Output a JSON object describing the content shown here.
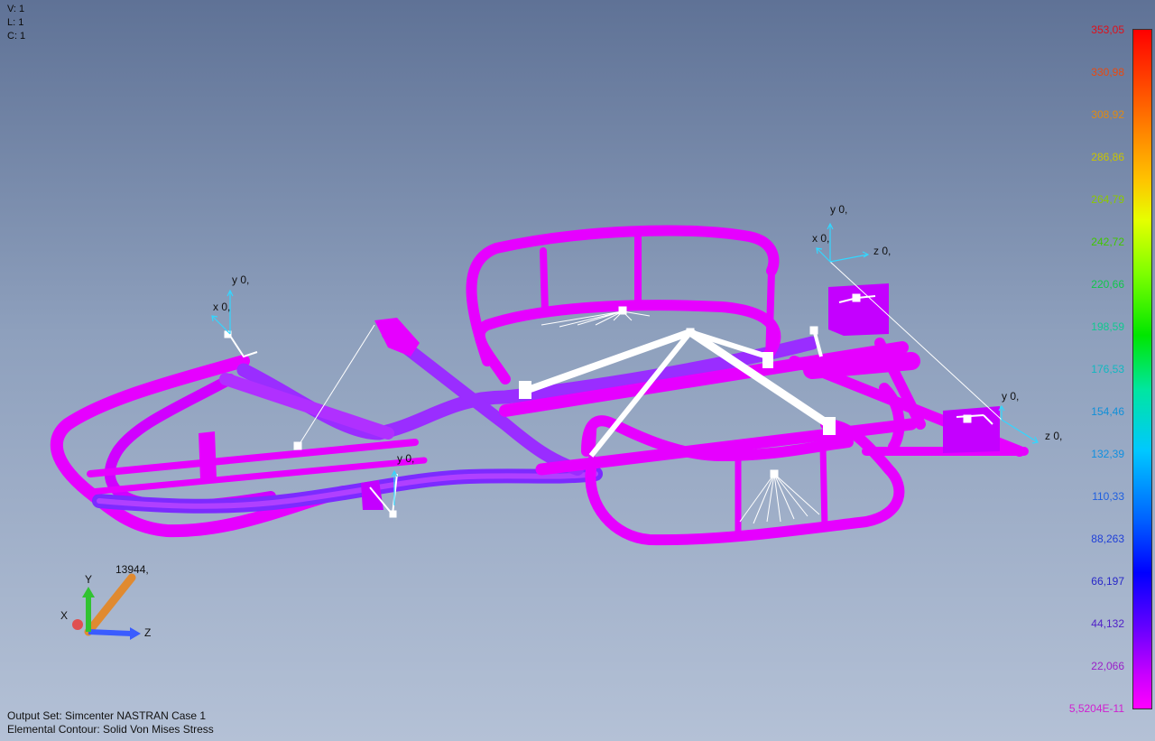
{
  "viewport_info": {
    "v": "V: 1",
    "l": "L: 1",
    "c": "C: 1"
  },
  "output": {
    "output_set": "Output Set: Simcenter NASTRAN Case 1",
    "contour": "Elemental Contour: Solid Von Mises Stress"
  },
  "legend": {
    "labels": [
      "353,05",
      "330,98",
      "308,92",
      "286,86",
      "264,79",
      "242,72",
      "220,66",
      "198,59",
      "176,53",
      "154,46",
      "132,39",
      "110,33",
      "88,263",
      "66,197",
      "44,132",
      "22,066",
      "5,5204E-11"
    ],
    "colors": [
      "#e0101a",
      "#e84a10",
      "#e28a10",
      "#c8c400",
      "#8cc800",
      "#40c800",
      "#10c84a",
      "#10c890",
      "#10b8c0",
      "#1090d8",
      "#1090e0",
      "#2060e0",
      "#2040d8",
      "#2828c8",
      "#5020c8",
      "#9a20c8",
      "#d020d0"
    ]
  },
  "view_triad": {
    "x": "X",
    "y": "Y",
    "z": "Z",
    "value": "13944,"
  },
  "csys_labels": {
    "left_y": "y 0,",
    "left_x": "x 0,",
    "center_y": "y 0,",
    "top_y": "y 0,",
    "top_x": "x 0,",
    "top_z": "z 0,",
    "right_y": "y 0,",
    "right_z": "z 0,"
  },
  "colors": {
    "frame": "#e600ff",
    "frame_shade": "#7b1fff",
    "rbe": "#ffffff",
    "csys": "#33d6ff",
    "bg_top": "#5f7296",
    "bg_bottom": "#b4c1d6"
  }
}
